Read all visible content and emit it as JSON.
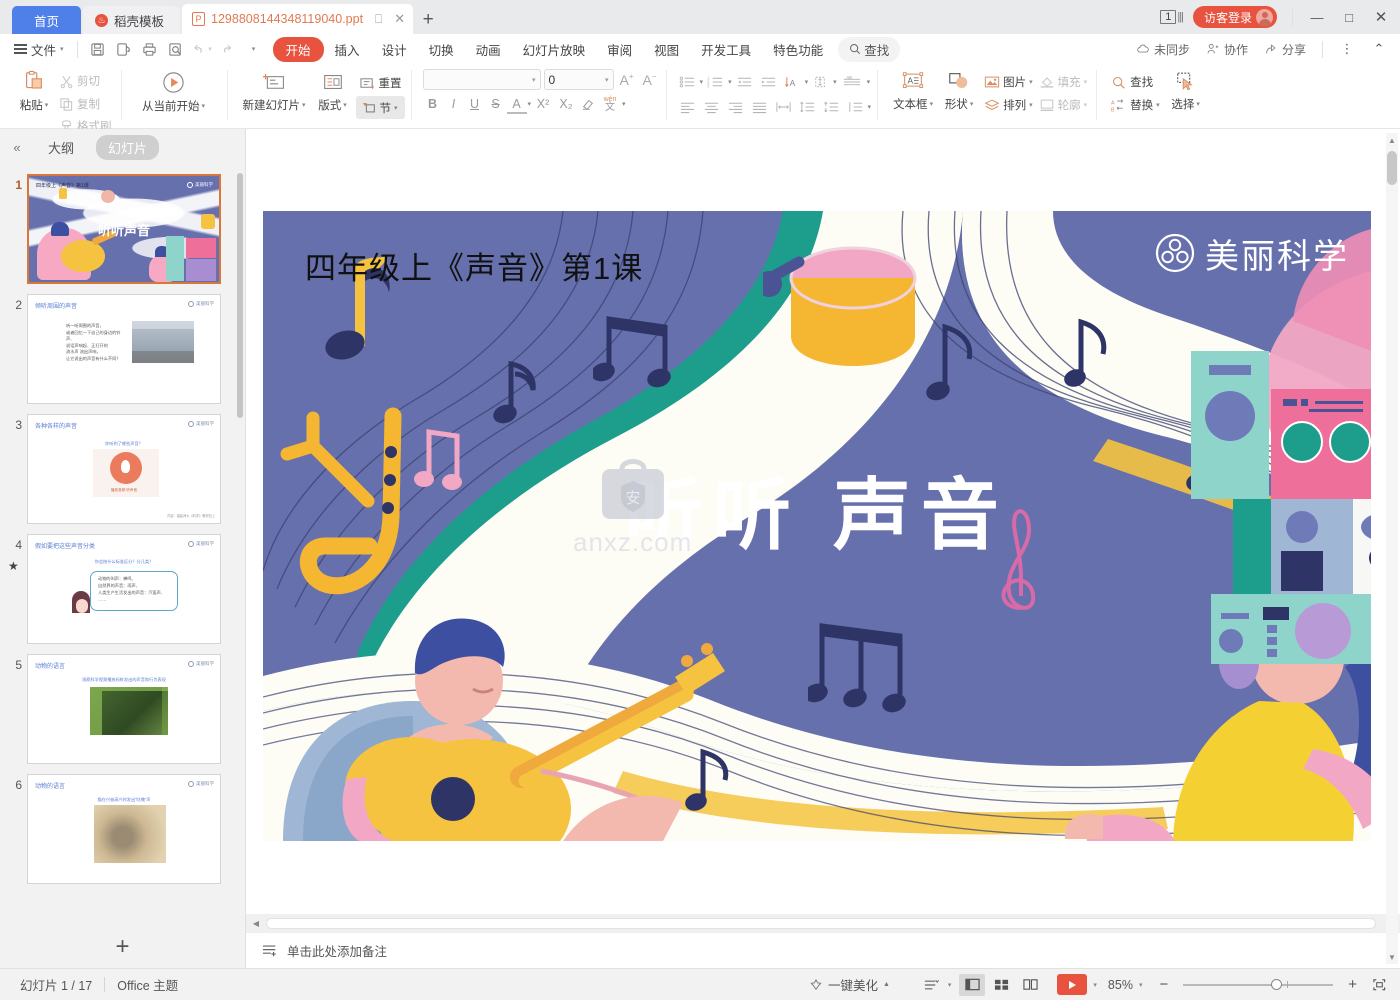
{
  "tabbar": {
    "tabs": [
      {
        "label": "首页",
        "type": "home"
      },
      {
        "label": "稻壳模板",
        "type": "tpl"
      },
      {
        "label": "1298808144348119040.ppt",
        "type": "doc"
      }
    ],
    "new_tab": "+",
    "page_badge": "1",
    "login_label": "访客登录",
    "window": {
      "minimize": "—",
      "maximize": "□",
      "close": "✕"
    }
  },
  "ribbon_tabs": {
    "file_label": "文件",
    "quick_icons": [
      "save-icon",
      "save-as-icon",
      "print-icon",
      "print-preview-icon",
      "undo-icon",
      "redo-icon",
      "customize-icon"
    ],
    "tabs": [
      "开始",
      "插入",
      "设计",
      "切换",
      "动画",
      "幻灯片放映",
      "审阅",
      "视图",
      "开发工具",
      "特色功能"
    ],
    "active_tab": "开始",
    "find_label": "查找",
    "right_items": [
      {
        "label": "未同步",
        "icon": "cloud-sync-icon"
      },
      {
        "label": "协作",
        "icon": "collaborate-icon"
      },
      {
        "label": "分享",
        "icon": "share-icon"
      }
    ],
    "more_icon": "more-vertical-icon",
    "collapse_icon": "chevron-up-icon"
  },
  "ribbon": {
    "clipboard": {
      "paste": "粘贴",
      "cut": "剪切",
      "copy": "复制",
      "format_painter": "格式刷"
    },
    "start_show": "从当前开始",
    "slides": {
      "new_slide": "新建幻灯片",
      "layout": "版式",
      "reset": "重置",
      "section": "节"
    },
    "font": {
      "font_name": "",
      "font_size": "0",
      "grow": "A",
      "shrink": "A",
      "bold": "B",
      "italic": "I",
      "underline": "U",
      "strike": "S",
      "font_color": "A",
      "superscript": "X²",
      "subscript": "X₂",
      "clear_format": "clear-format-icon",
      "phonetic": "文"
    },
    "paragraph": {
      "bullets": "bullet-list-icon",
      "numbering": "numbered-list-icon",
      "decrease_indent": "decrease-indent-icon",
      "increase_indent": "increase-indent-icon",
      "text_direction": "text-direction-icon",
      "align_text": "align-text-icon",
      "columns": "columns-icon",
      "align_left": "align-left-icon",
      "align_center": "align-center-icon",
      "align_right": "align-right-icon",
      "justify": "justify-icon",
      "distribute": "distribute-icon",
      "line_spacing": "line-spacing-icon",
      "para_spacing": "para-spacing-icon",
      "spacing_more": "spacing-dropdown-icon"
    },
    "drawing": {
      "textbox": "文本框",
      "shape": "形状",
      "picture": "图片",
      "arrange": "排列",
      "fill": "填充",
      "outline": "轮廓"
    },
    "editing": {
      "find": "查找",
      "replace": "替换",
      "select": "选择"
    }
  },
  "sidebar": {
    "collapse_icon": "chevrons-left-icon",
    "tabs": [
      {
        "label": "大纲",
        "active": false
      },
      {
        "label": "幻灯片",
        "active": true
      }
    ],
    "add_slide": "+",
    "slides": [
      {
        "number": "1",
        "selected": true,
        "title": "四年级上《声音》第1课",
        "body": "听听声音",
        "logo": "美丽科学"
      },
      {
        "number": "2",
        "selected": false,
        "title": "倾听周围的声音",
        "body": "听一听周围的声音，\n或者回忆一下自己的身边的铃声、\n说话声响起、正打开的\n流水声 流出声响，\n让它说出的声音有什么不同？",
        "logo": "美丽科学"
      },
      {
        "number": "3",
        "selected": false,
        "title": "各种各样的声音",
        "body": "你听到了哪些声音？",
        "caption": "播放音频 听声音",
        "footer": "内容：福建师大《科学》教材四上",
        "logo": "美丽科学"
      },
      {
        "number": "4",
        "selected": false,
        "starred": true,
        "title": "假如要把这些声音分类",
        "body": "你会按什么标准区分？分几类？",
        "box": "动物的叫声：蝉鸣、\n自然界的声音：雨声、\n人类生产生活发出的声音：汽笛声、\n……",
        "logo": "美丽科学"
      },
      {
        "number": "5",
        "selected": false,
        "title": "动物的语言",
        "body": "观察科学视频播放蚂蚱发出的声音和行为表现",
        "logo": "美丽科学"
      },
      {
        "number": "6",
        "selected": false,
        "title": "动物的语言",
        "body": "猫在兴奋高兴时发出“咕噜”声",
        "logo": "美丽科学"
      }
    ]
  },
  "slide": {
    "heading": "四年级上《声音》第1课",
    "big_title": "听听 声音",
    "brand": "美丽科学",
    "watermark_text": "anxz.com",
    "watermark_glyph": "安"
  },
  "notes": {
    "icon": "add-notes-icon",
    "placeholder": "单击此处添加备注"
  },
  "status": {
    "slide_counter": "幻灯片 1 / 17",
    "theme": "Office 主题",
    "beautify": "一键美化",
    "views": [
      "normal-view-icon",
      "slide-sorter-icon",
      "reading-view-icon"
    ],
    "play": "play-icon",
    "zoom_level": "85%",
    "zoom_out": "−",
    "zoom_in": "+",
    "fit_window": "fit-to-window-icon"
  },
  "colors": {
    "accent": "#e8533f",
    "home_tab": "#4f7fe8",
    "slide_bg": "#6670ad",
    "selected_border": "#d8763c"
  }
}
